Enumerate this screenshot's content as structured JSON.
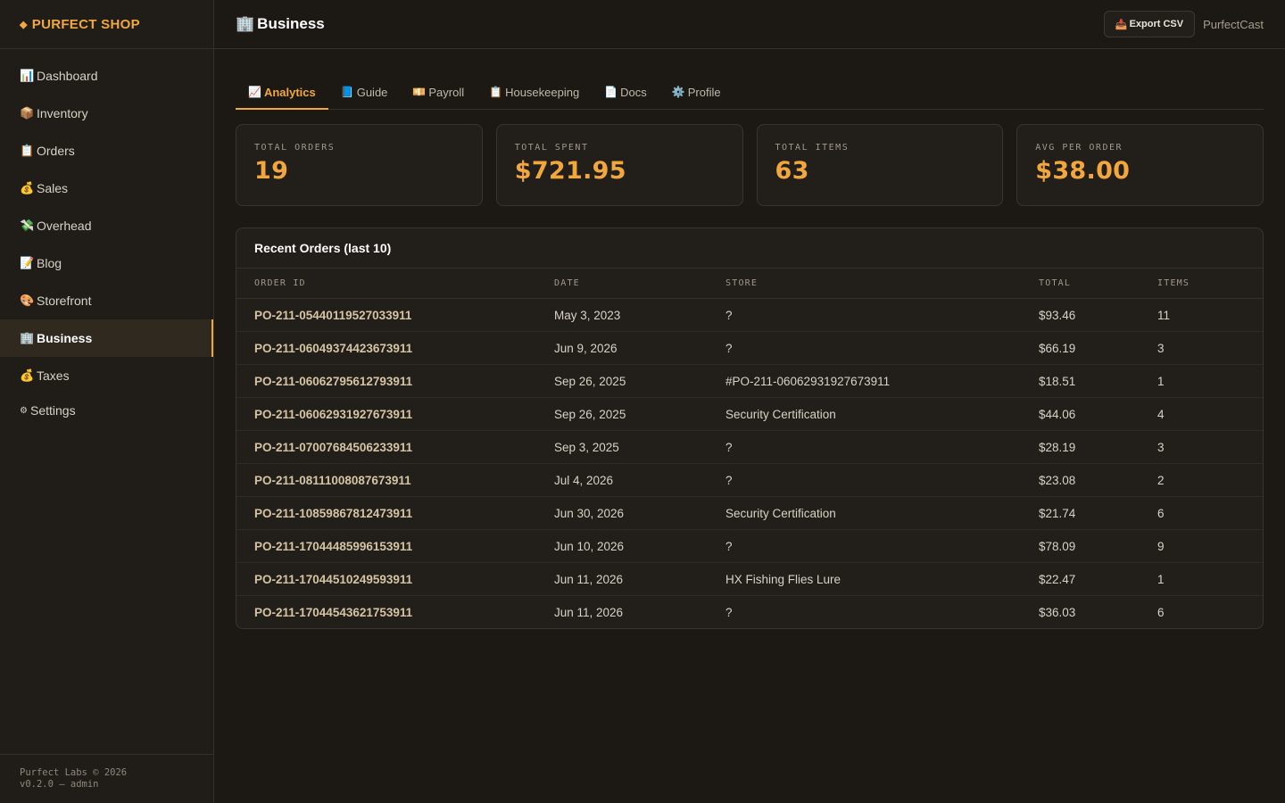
{
  "brand": {
    "icon": "diamond-icon",
    "name": "PURFECT SHOP"
  },
  "sidebar": {
    "items": [
      {
        "icon": "📊",
        "icon_name": "bar-chart-icon",
        "label": "Dashboard"
      },
      {
        "icon": "📦",
        "icon_name": "package-icon",
        "label": "Inventory"
      },
      {
        "icon": "📋",
        "icon_name": "clipboard-icon",
        "label": "Orders"
      },
      {
        "icon": "💰",
        "icon_name": "money-bag-icon",
        "label": "Sales"
      },
      {
        "icon": "💸",
        "icon_name": "money-wings-icon",
        "label": "Overhead"
      },
      {
        "icon": "📝",
        "icon_name": "memo-icon",
        "label": "Blog"
      },
      {
        "icon": "🎨",
        "icon_name": "palette-icon",
        "label": "Storefront"
      },
      {
        "icon": "🏢",
        "icon_name": "office-building-icon",
        "label": "Business",
        "active": true
      },
      {
        "icon": "💰",
        "icon_name": "money-bag-icon",
        "label": "Taxes"
      },
      {
        "icon": "⚙",
        "icon_name": "gear-icon",
        "label": "Settings"
      }
    ],
    "footer": {
      "line1": "Purfect Labs © 2026",
      "line2": "v0.2.0 — admin"
    }
  },
  "header": {
    "title_icon": "🏢",
    "title": "Business",
    "export_icon": "📥",
    "export_label": "Export CSV",
    "user": "PurfectCast"
  },
  "tabs": [
    {
      "icon": "📈",
      "label": "Analytics",
      "active": true
    },
    {
      "icon": "📘",
      "label": "Guide"
    },
    {
      "icon": "💴",
      "label": "Payroll"
    },
    {
      "icon": "📋",
      "label": "Housekeeping"
    },
    {
      "icon": "📄",
      "label": "Docs"
    },
    {
      "icon": "⚙️",
      "label": "Profile"
    }
  ],
  "stats": [
    {
      "label": "TOTAL ORDERS",
      "value": "19"
    },
    {
      "label": "TOTAL SPENT",
      "value": "$721.95"
    },
    {
      "label": "TOTAL ITEMS",
      "value": "63"
    },
    {
      "label": "AVG PER ORDER",
      "value": "$38.00"
    }
  ],
  "orders": {
    "title": "Recent Orders (last 10)",
    "columns": [
      "ORDER ID",
      "DATE",
      "STORE",
      "TOTAL",
      "ITEMS"
    ],
    "rows": [
      [
        "PO-211-05440119527033911",
        "May 3, 2023",
        "?",
        "$93.46",
        "11"
      ],
      [
        "PO-211-06049374423673911",
        "Jun 9, 2026",
        "?",
        "$66.19",
        "3"
      ],
      [
        "PO-211-06062795612793911",
        "Sep 26, 2025",
        "#PO-211-06062931927673911",
        "$18.51",
        "1"
      ],
      [
        "PO-211-06062931927673911",
        "Sep 26, 2025",
        "Security Certification",
        "$44.06",
        "4"
      ],
      [
        "PO-211-07007684506233911",
        "Sep 3, 2025",
        "?",
        "$28.19",
        "3"
      ],
      [
        "PO-211-08111008087673911",
        "Jul 4, 2026",
        "?",
        "$23.08",
        "2"
      ],
      [
        "PO-211-10859867812473911",
        "Jun 30, 2026",
        "Security Certification",
        "$21.74",
        "6"
      ],
      [
        "PO-211-17044485996153911",
        "Jun 10, 2026",
        "?",
        "$78.09",
        "9"
      ],
      [
        "PO-211-17044510249593911",
        "Jun 11, 2026",
        "HX Fishing Flies Lure",
        "$22.47",
        "1"
      ],
      [
        "PO-211-17044543621753911",
        "Jun 11, 2026",
        "?",
        "$36.03",
        "6"
      ]
    ]
  },
  "colors": {
    "accent": "#f2a73c",
    "background": "#1c1915",
    "sidebar": "#201d19"
  }
}
